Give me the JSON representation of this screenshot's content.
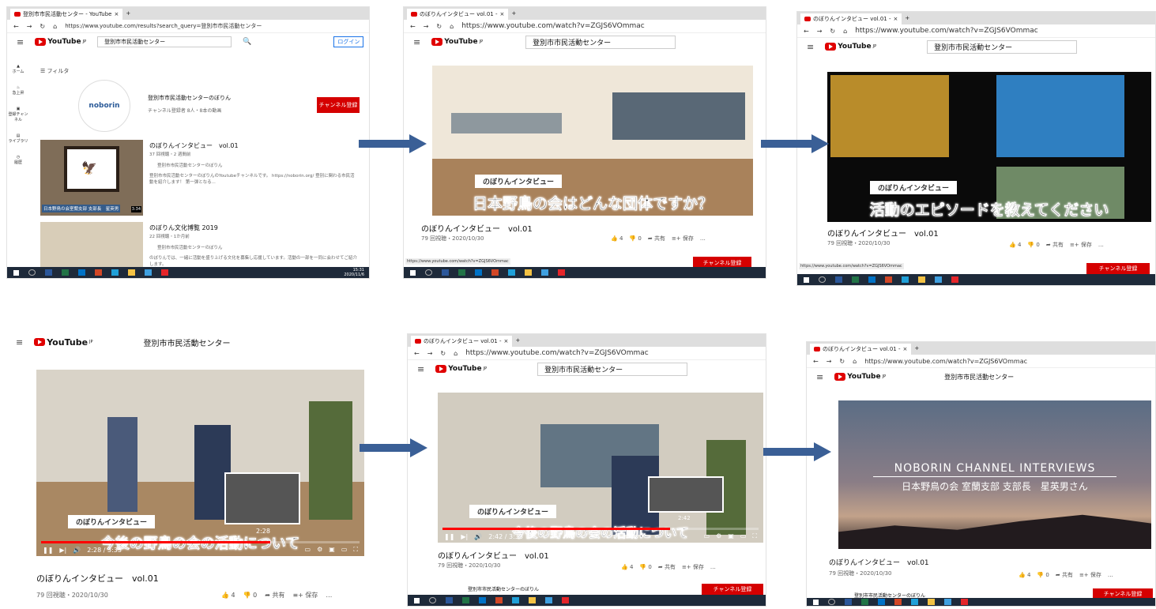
{
  "browser": {
    "tab_title": "のぼりんインタビュー vol.01 - ",
    "tab_title_search": "登別市市民活動センター - YouTube",
    "url_watch": "https://www.youtube.com/watch?v=ZGJS6VOmmac",
    "url_search": "https://www.youtube.com/results?search_query=登別市市民活動センター",
    "new_tab": "+",
    "close": "×"
  },
  "youtube": {
    "logo": "YouTube",
    "logo_sup": "JP",
    "search_query": "登別市市民活動センター",
    "login": "ログイン",
    "filter": "フィルタ"
  },
  "sidebar": [
    "ホーム",
    "急上昇",
    "登録チャンネル",
    "ライブラリ",
    "履歴"
  ],
  "channel": {
    "avatar_text": "noborin",
    "name": "登別市市民活動センターのぼりん",
    "meta": "チャンネル登録者 8人・8本の動画",
    "subscribe": "チャンネル登録"
  },
  "results": [
    {
      "title": "のぼりんインタビュー　vol.01",
      "meta": "37 回視聴・2 週間前",
      "channel": "登別市市民活動センターのぼりん",
      "desc": "登別市市民活動センターのぼりんのYoutubeチャンネルです。 https://noborin.org/ 登別に関わる市民活動を紹介します！ 第一弾となる...",
      "thumb_caption": "日本野鳥の会室蘭支部 支部長　星英男",
      "duration": "3:34"
    },
    {
      "title": "のぼりん文化博覧 2019",
      "meta": "22 回視聴・1か月前",
      "channel": "登別市市民活動センターのぼりん",
      "desc": "のぼりんでは、一緒に活動を盛り上げる文化を募集し応援しています。活動の一部を一同に会わせてご紹介します。"
    }
  ],
  "video": {
    "title": "のぼりんインタビュー　vol.01",
    "meta": "79 回視聴・2020/10/30",
    "likes": "4",
    "dislikes": "0",
    "share": "共有",
    "save": "保存",
    "more": "…",
    "channel_name": "登別市市民活動センターのぼりん",
    "subscribe": "チャンネル登録",
    "status_url": "https://www.youtube.com/watch?v=ZGJS6VOmmac",
    "time_1": "2:28",
    "time_2": "2:42",
    "time_display_1": "2:28 / 3:33",
    "time_display_2": "2:42 / 3:33",
    "progress": 0.72
  },
  "subtitles": {
    "tag": "のぼりんインタビュー",
    "q1": "日本野鳥の会はどんな団体ですか？",
    "q2": "活動のエピソードを教えてください",
    "q3": "今後の野鳥の会の活動について"
  },
  "interview_card": {
    "line1": "NOBORIN CHANNEL INTERVIEWS",
    "line2": "日本野鳥の会 室蘭支部 支部長　星英男さん"
  },
  "system_tray": {
    "time": "15:31",
    "date": "2020/11/6"
  },
  "colors": {
    "youtube_red": "#e00000",
    "arrow_blue": "#3a5f96",
    "subscribe_red": "#d50000",
    "taskbar": "#1e2a3a"
  }
}
